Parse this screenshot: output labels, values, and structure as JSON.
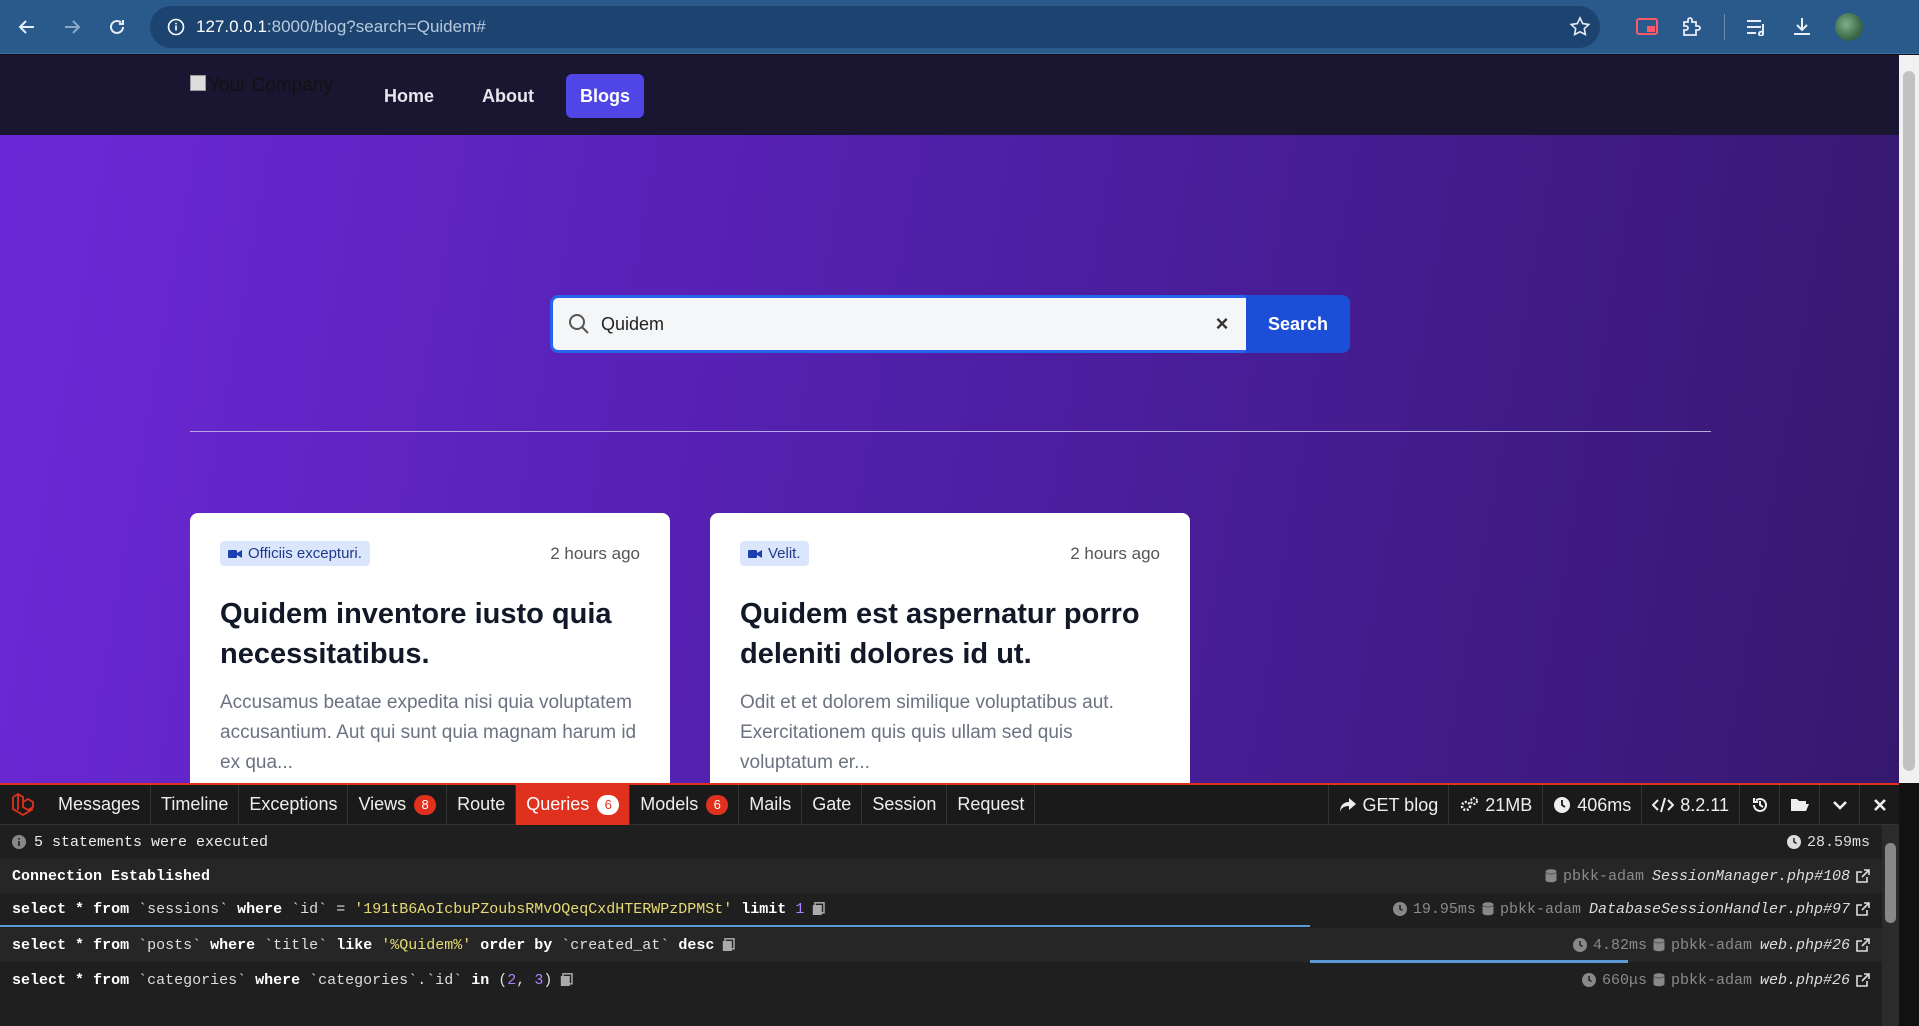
{
  "browser": {
    "url_host": "127.0.0.1",
    "url_rest": ":8000/blog?search=Quidem#"
  },
  "nav": {
    "logo_alt": "Your Company",
    "links": [
      {
        "label": "Home"
      },
      {
        "label": "About"
      },
      {
        "label": "Blogs"
      }
    ]
  },
  "search": {
    "value": "Quidem",
    "clear_label": "×",
    "button_label": "Search"
  },
  "posts": [
    {
      "category": "Officiis excepturi.",
      "time": "2 hours ago",
      "title": "Quidem inventore iusto quia necessitatibus.",
      "excerpt": "Accusamus beatae expedita nisi quia voluptatem accusantium. Aut qui sunt quia magnam harum id ex qua..."
    },
    {
      "category": "Velit.",
      "time": "2 hours ago",
      "title": "Quidem est aspernatur porro deleniti dolores id ut.",
      "excerpt": "Odit et et dolorem similique voluptatibus aut. Exercitationem quis quis ullam sed quis voluptatum er..."
    }
  ],
  "debugbar": {
    "tabs": [
      {
        "label": "Messages"
      },
      {
        "label": "Timeline"
      },
      {
        "label": "Exceptions"
      },
      {
        "label": "Views",
        "count": "8"
      },
      {
        "label": "Route"
      },
      {
        "label": "Queries",
        "count": "6"
      },
      {
        "label": "Models",
        "count": "6"
      },
      {
        "label": "Mails"
      },
      {
        "label": "Gate"
      },
      {
        "label": "Session"
      },
      {
        "label": "Request"
      }
    ],
    "request": "GET blog",
    "memory": "21MB",
    "duration": "406ms",
    "php_version": "8.2.11",
    "summary": "5 statements were executed",
    "total_time": "28.59ms",
    "connection": {
      "label": "Connection Established",
      "db": "pbkk-adam",
      "file": "SessionManager.php#108"
    },
    "queries": [
      {
        "select": "select",
        "star": "*",
        "from": "from",
        "table": "`sessions`",
        "where": "where",
        "col": "`id`",
        "op": "=",
        "value": "'191tB6AoIcbuPZoubsRMvOQeqCxdHTERWPzDPMSt'",
        "extra_kw": "limit",
        "extra_val": "1",
        "time": "19.95ms",
        "db": "pbkk-adam",
        "file": "DatabaseSessionHandler.php#97"
      },
      {
        "select": "select",
        "star": "*",
        "from": "from",
        "table": "`posts`",
        "where": "where",
        "col": "`title`",
        "op": "like",
        "value": "'%Quidem%'",
        "extra_kw": "order by",
        "extra_val": "`created_at`",
        "extra_kw2": "desc",
        "time": "4.82ms",
        "db": "pbkk-adam",
        "file": "web.php#26"
      },
      {
        "select": "select",
        "star": "*",
        "from": "from",
        "table": "`categories`",
        "where": "where",
        "col": "`categories`.`id`",
        "op": "in",
        "open": "(",
        "v1": "2",
        "comma": ",",
        "v2": "3",
        "close": ")",
        "time": "660μs",
        "db": "pbkk-adam",
        "file": "web.php#26"
      }
    ]
  }
}
